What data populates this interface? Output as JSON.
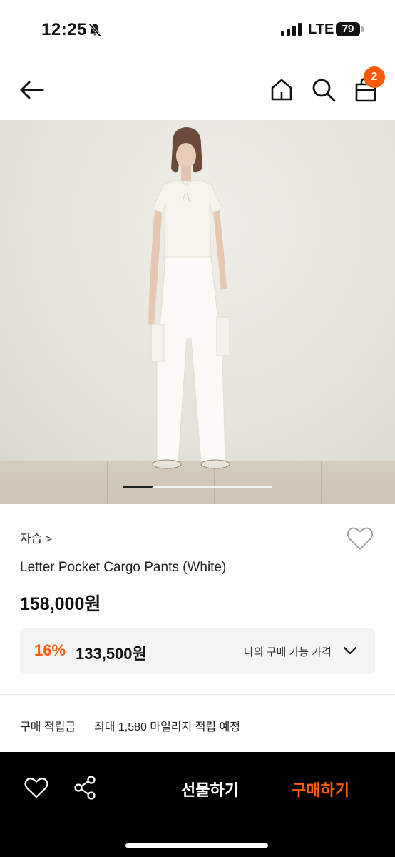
{
  "status_bar": {
    "time": "12:25",
    "network": "LTE",
    "battery": "79"
  },
  "header": {
    "cart_count": "2"
  },
  "product": {
    "brand": "자습",
    "brand_chevron": ">",
    "name": "Letter Pocket Cargo Pants (White)",
    "price": "158,000원",
    "discount_rate": "16%",
    "discount_price": "133,500원",
    "price_option_label": "나의 구매 가능 가격"
  },
  "points": {
    "label": "구매 적립금",
    "value": "최대 1,580 마일리지 적립 예정"
  },
  "action_bar": {
    "gift_label": "선물하기",
    "buy_label": "구매하기"
  },
  "colors": {
    "accent": "#ff5a0a",
    "action_bar_bg": "#000000",
    "price_box_bg": "#f4f4f4"
  },
  "carousel": {
    "progress": 0.2
  }
}
